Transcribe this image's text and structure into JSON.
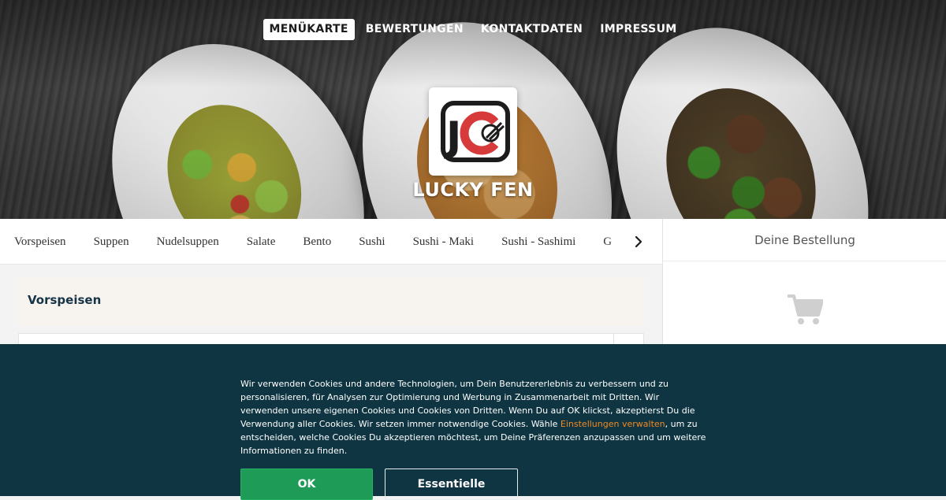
{
  "nav": {
    "items": [
      {
        "label": "MENÜKARTE",
        "active": true
      },
      {
        "label": "BEWERTUNGEN",
        "active": false
      },
      {
        "label": "KONTAKTDATEN",
        "active": false
      },
      {
        "label": "IMPRESSUM",
        "active": false
      }
    ]
  },
  "restaurant": {
    "name": "LUCKY FEN",
    "logo_text": "JC"
  },
  "categories": {
    "items": [
      "Vorspeisen",
      "Suppen",
      "Nudelsuppen",
      "Salate",
      "Bento",
      "Sushi",
      "Sushi - Maki",
      "Sushi - Sashimi",
      "G"
    ],
    "next_icon": "chevron-right-icon"
  },
  "main": {
    "section_title": "Vorspeisen"
  },
  "order": {
    "title": "Deine Bestellung",
    "icon": "shopping-cart-icon"
  },
  "cookie": {
    "text_before": "Wir verwenden Cookies und andere Technologien, um Dein Benutzererlebnis zu verbessern und zu personalisieren, für Analysen zur Optimierung und Werbung in Zusammenarbeit mit Dritten. Wir verwenden unsere eigenen Cookies und Cookies von Dritten. Wenn Du auf OK klickst, akzeptierst Du die Verwendung aller Cookies. Wir setzen immer notwendige Cookies. Wähle ",
    "link_text": "Einstellungen verwalten",
    "text_after": ", um zu entscheiden, welche Cookies Du akzeptieren möchtest, um Deine Präferenzen anzupassen und um weitere Informationen zu finden.",
    "ok_label": "OK",
    "essential_label": "Essentielle"
  },
  "colors": {
    "banner_bg": "#0f3542",
    "ok_green": "#1e9b56",
    "link_orange": "#f08a24",
    "section_title": "#173447",
    "logo_red": "#d63a3a"
  }
}
